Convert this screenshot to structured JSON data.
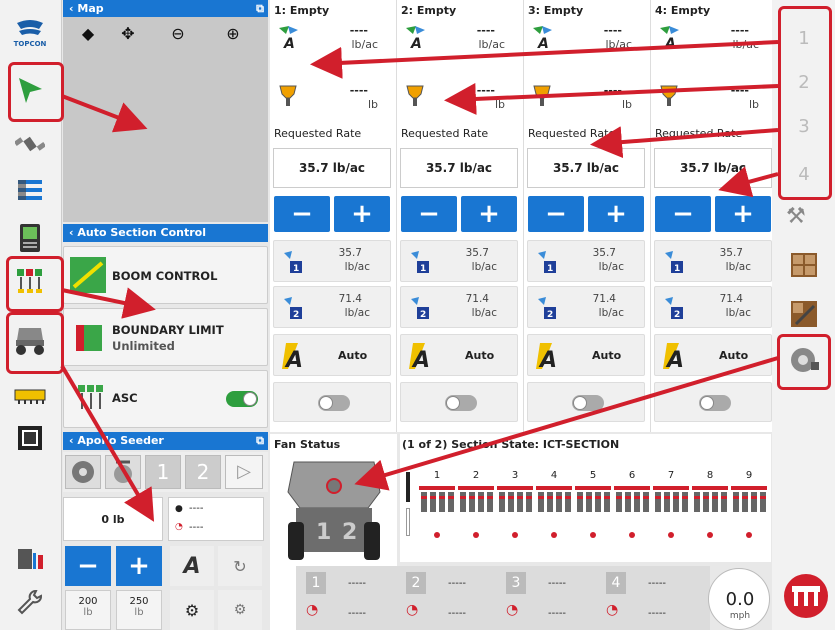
{
  "left_sidebar": {
    "logo_text": "TOPCON"
  },
  "map": {
    "title": "Map"
  },
  "asc": {
    "title": "Auto Section Control",
    "boom_control": "BOOM CONTROL",
    "boundary_limit": "BOUNDARY LIMIT",
    "boundary_value": "Unlimited",
    "asc_label": "ASC"
  },
  "apollo": {
    "title": "Apollo Seeder",
    "weight": "0 lb",
    "status_a": "----",
    "status_b": "----",
    "preset_1": "200",
    "preset_1_unit": "lb",
    "preset_2": "250",
    "preset_2_unit": "lb",
    "tab_1": "1",
    "tab_2": "2"
  },
  "columns": [
    {
      "title": "1: Empty",
      "rate_value": "----",
      "rate_unit": "lb/ac",
      "weight_value": "----",
      "weight_unit": "lb",
      "requested_label": "Requested Rate",
      "requested_rate": "35.7 lb/ac",
      "preset1_value": "35.7",
      "preset1_unit": "lb/ac",
      "preset2_value": "71.4",
      "preset2_unit": "lb/ac",
      "mode": "Auto"
    },
    {
      "title": "2: Empty",
      "rate_value": "----",
      "rate_unit": "lb/ac",
      "weight_value": "----",
      "weight_unit": "lb",
      "requested_label": "Requested Rate",
      "requested_rate": "35.7 lb/ac",
      "preset1_value": "35.7",
      "preset1_unit": "lb/ac",
      "preset2_value": "71.4",
      "preset2_unit": "lb/ac",
      "mode": "Auto"
    },
    {
      "title": "3: Empty",
      "rate_value": "----",
      "rate_unit": "lb/ac",
      "weight_value": "----",
      "weight_unit": "lb",
      "requested_label": "Requested Rate",
      "requested_rate": "35.7 lb/ac",
      "preset1_value": "35.7",
      "preset1_unit": "lb/ac",
      "preset2_value": "71.4",
      "preset2_unit": "lb/ac",
      "mode": "Auto"
    },
    {
      "title": "4: Empty",
      "rate_value": "----",
      "rate_unit": "lb/ac",
      "weight_value": "----",
      "weight_unit": "lb",
      "requested_label": "Requested Rate",
      "requested_rate": "35.7 lb/ac",
      "preset1_value": "35.7",
      "preset1_unit": "lb/ac",
      "preset2_value": "71.4",
      "preset2_unit": "lb/ac",
      "mode": "Auto"
    }
  ],
  "fan": {
    "title": "Fan Status",
    "bin_1": "1",
    "bin_2": "2"
  },
  "section_state": {
    "title": "(1 of 2) Section State: ICT-SECTION",
    "sections": [
      "1",
      "2",
      "3",
      "4",
      "5",
      "6",
      "7",
      "8",
      "9"
    ]
  },
  "right_sidebar": {
    "numbers": [
      "1",
      "2",
      "3",
      "4"
    ]
  },
  "bottom_bar": {
    "bins": [
      {
        "num": "1",
        "top": "-----",
        "bottom": "-----"
      },
      {
        "num": "2",
        "top": "-----",
        "bottom": "-----"
      },
      {
        "num": "3",
        "top": "-----",
        "bottom": "-----"
      },
      {
        "num": "4",
        "top": "-----",
        "bottom": "-----"
      }
    ],
    "speed": "0.0",
    "speed_unit": "mph"
  },
  "colors": {
    "accent": "#1976d2",
    "highlight": "#d11f2c",
    "toggle_on": "#2e9e3e"
  }
}
